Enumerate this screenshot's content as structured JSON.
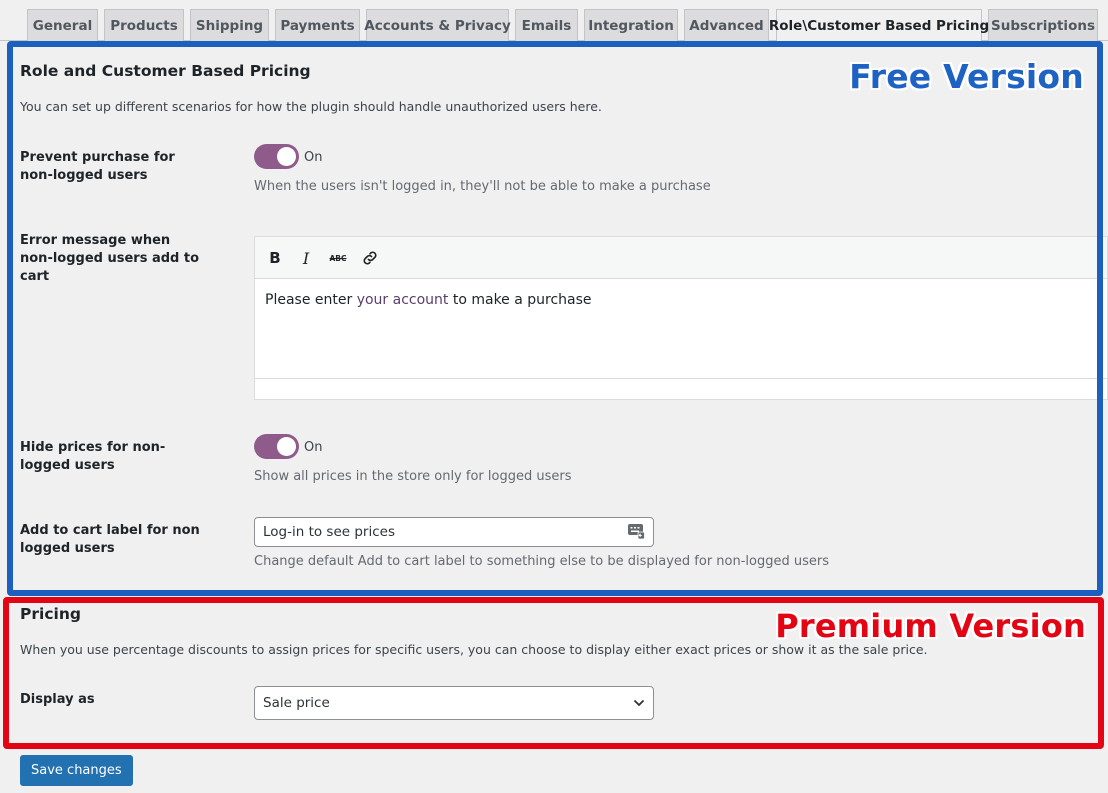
{
  "tabs": [
    {
      "label": "General",
      "active": false
    },
    {
      "label": "Products",
      "active": false
    },
    {
      "label": "Shipping",
      "active": false
    },
    {
      "label": "Payments",
      "active": false
    },
    {
      "label": "Accounts & Privacy",
      "active": false
    },
    {
      "label": "Emails",
      "active": false
    },
    {
      "label": "Integration",
      "active": false
    },
    {
      "label": "Advanced",
      "active": false
    },
    {
      "label": "Role\\Customer Based Pricing",
      "active": true
    },
    {
      "label": "Subscriptions",
      "active": false
    }
  ],
  "section_main": {
    "title": "Role and Customer Based Pricing",
    "description": "You can set up different scenarios for how the plugin should handle unauthorized users here."
  },
  "prevent_purchase": {
    "label": "Prevent purchase for non-logged users",
    "toggle_state": "On",
    "help": "When the users isn't logged in, they'll not be able to make a purchase"
  },
  "error_message": {
    "label": "Error message when non-logged users add to cart",
    "toolbar": {
      "bold": "B",
      "italic": "I",
      "strike": "ABC"
    },
    "content_before": "Please enter ",
    "content_link": "your account",
    "content_after": " to make a purchase"
  },
  "hide_prices": {
    "label": "Hide prices for non-logged users",
    "toggle_state": "On",
    "help": "Show all prices in the store only for logged users"
  },
  "add_to_cart_label": {
    "label": "Add to cart label for non logged users",
    "value": "Log-in to see prices",
    "help": "Change default Add to cart label to something else to be displayed for non-logged users"
  },
  "section_pricing": {
    "title": "Pricing",
    "description": "When you use percentage discounts to assign prices for specific users, you can choose to display either exact prices or show it as the sale price."
  },
  "display_as": {
    "label": "Display as",
    "selected": "Sale price"
  },
  "save_button": "Save changes",
  "overlays": {
    "free_label": "Free Version",
    "premium_label": "Premium Version",
    "free_color": "#1c5fbf",
    "premium_color": "#e30513"
  },
  "colors": {
    "toggle_on": "#8e5b8a",
    "primary_button": "#2271b1",
    "link_text": "#5b3e6e"
  }
}
